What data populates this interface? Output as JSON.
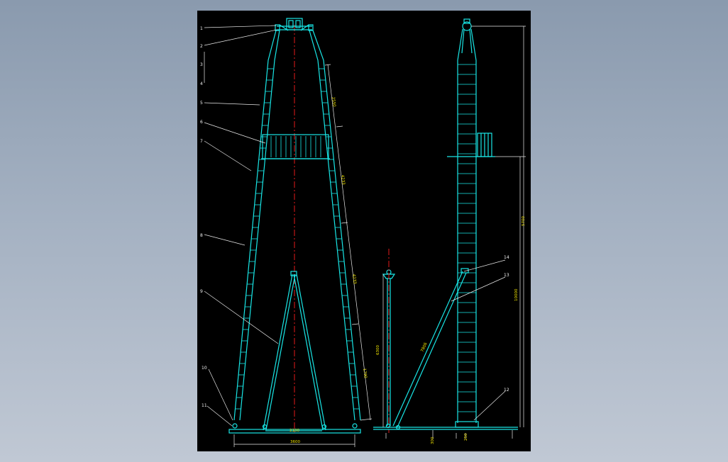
{
  "drawing": {
    "background_color": "#000000",
    "structure_color": "#19e6e6",
    "centerline_color": "#d01818",
    "dimension_color": "#f2e600",
    "leader_color": "#e8e8e8",
    "part_numbers": [
      "1",
      "2",
      "3",
      "4",
      "5",
      "6",
      "7",
      "8",
      "9",
      "10",
      "11",
      "12",
      "13",
      "14"
    ],
    "front_dimensions": {
      "base_width": "3600",
      "leg_upper": "2550",
      "leg_middle": "4233",
      "leg_lower": "4233",
      "leg_bottom": "1790",
      "inner_base": "2100"
    },
    "side_dimensions": {
      "upper_height": "5700",
      "overall_height": "10000",
      "post_height": "6300",
      "brace_length": "7806",
      "base_offset": "300",
      "foot_offset": "250"
    }
  }
}
